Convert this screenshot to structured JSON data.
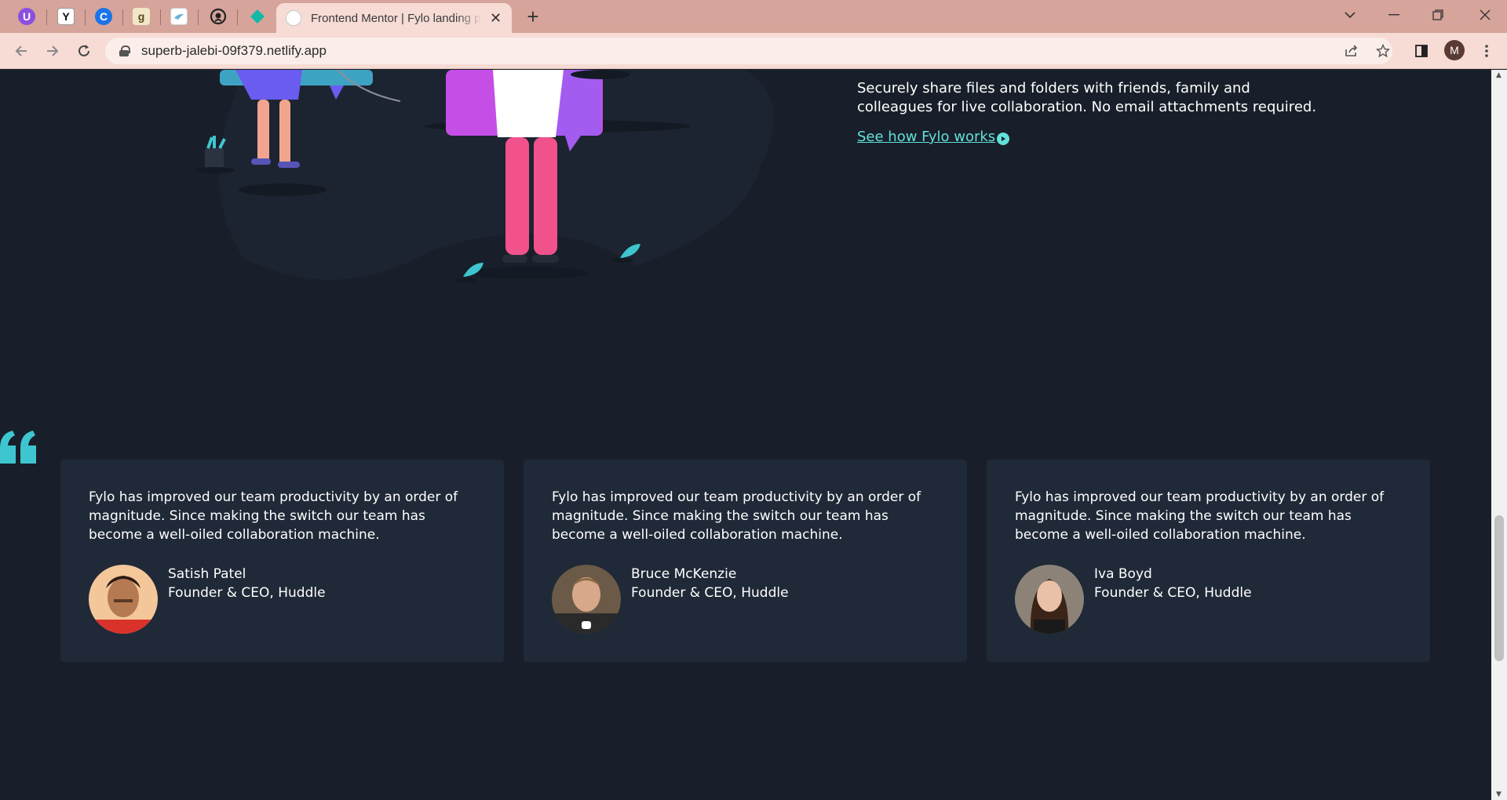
{
  "browser": {
    "pinned_tabs": [
      {
        "icon": "U",
        "color": "#8a4fe0"
      },
      {
        "icon": "Y",
        "color": "#ffffff"
      },
      {
        "icon": "C",
        "color": "#1a73e8"
      },
      {
        "icon": "g",
        "color": "#f1e6c8"
      },
      {
        "icon": "bird",
        "color": "#ffffff"
      },
      {
        "icon": "github",
        "color": "#222222"
      },
      {
        "icon": "diamond",
        "color": "#14b8a6"
      }
    ],
    "active_tab_title": "Frontend Mentor | Fylo landing page",
    "url": "superb-jalebi-09f379.netlify.app",
    "profile_initial": "M"
  },
  "feature": {
    "text": "Securely share files and folders with friends, family and colleagues for live collaboration. No email attachments required.",
    "link": "See how Fylo works"
  },
  "testimonials": [
    {
      "quote": "Fylo has improved our team productivity by an order of magnitude. Since making the switch our team has become a well-oiled collaboration machine.",
      "name": "Satish Patel",
      "role": "Founder & CEO, Huddle"
    },
    {
      "quote": "Fylo has improved our team productivity by an order of magnitude. Since making the switch our team has become a well-oiled collaboration machine.",
      "name": "Bruce McKenzie",
      "role": "Founder & CEO, Huddle"
    },
    {
      "quote": "Fylo has improved our team productivity by an order of magnitude. Since making the switch our team has become a well-oiled collaboration machine.",
      "name": "Iva Boyd",
      "role": "Founder & CEO, Huddle"
    }
  ],
  "colors": {
    "page_bg": "#181f2a",
    "card_bg": "#1f2937",
    "accent": "#62e0d9",
    "tab_bar": "#d6a49a"
  }
}
